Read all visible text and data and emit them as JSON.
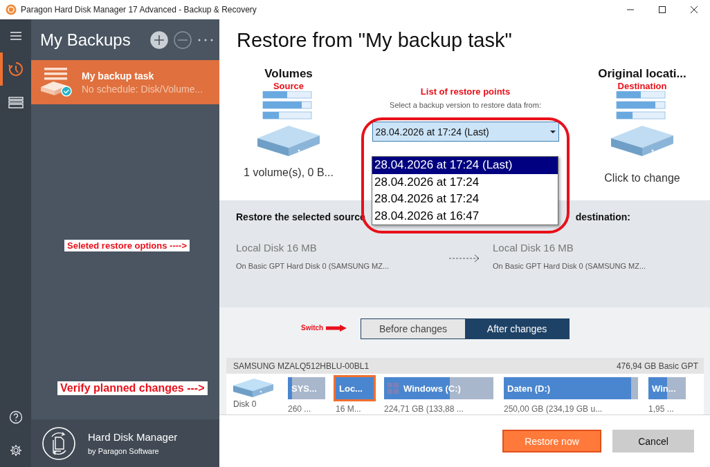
{
  "window": {
    "title": "Paragon Hard Disk Manager 17 Advanced - Backup & Recovery"
  },
  "nav_rail": {
    "items": [
      {
        "kind": "menu",
        "selected": false
      },
      {
        "kind": "backups",
        "selected": true
      },
      {
        "kind": "disks",
        "selected": false
      }
    ],
    "bottom": [
      {
        "kind": "help"
      },
      {
        "kind": "settings"
      }
    ]
  },
  "sidebar": {
    "title": "My Backups",
    "actions": [
      {
        "kind": "add",
        "disabled": false
      },
      {
        "kind": "remove",
        "disabled": true
      },
      {
        "kind": "more",
        "disabled": false
      }
    ],
    "tasks": [
      {
        "name": "My backup task",
        "detail": "No schedule: Disk/Volume...",
        "selected": true
      }
    ],
    "annotations": [
      "Seleted restore options ---->",
      "Verify planned changes --->"
    ],
    "brand": {
      "name": "Hard Disk Manager",
      "vendor": "by Paragon Software"
    }
  },
  "restore": {
    "title": "Restore from \"My backup task\"",
    "source": {
      "label": "Volumes",
      "annotation": "Source",
      "summary": "1 volume(s), 0 B..."
    },
    "restore_points": {
      "annotation": "List of restore points",
      "prompt": "Select a backup version to restore data from:",
      "value": "28.04.2026 at 17:24 (Last)",
      "expanded": true,
      "options": [
        {
          "label": "28.04.2026 at 17:24 (Last)",
          "selected": true
        },
        {
          "label": "28.04.2026 at 17:24",
          "selected": false
        },
        {
          "label": "28.04.2026 at 17:24",
          "selected": false
        },
        {
          "label": "28.04.2026 at 16:47",
          "selected": false
        }
      ]
    },
    "destination": {
      "label": "Original locati...",
      "annotation": "Destination",
      "summary": "Click to change"
    }
  },
  "mapping": {
    "heading_start": "Restore the selected source",
    "heading_end": "destination:",
    "from": {
      "name": "Local Disk 16 MB",
      "location": "On Basic GPT Hard Disk 0 (SAMSUNG MZ..."
    },
    "to": {
      "name": "Local Disk 16 MB",
      "location": "On Basic GPT Hard Disk 0 (SAMSUNG MZ..."
    }
  },
  "view_switch": {
    "annotation": "Switch",
    "options": [
      {
        "label": "Before changes",
        "selected": false
      },
      {
        "label": "After changes",
        "selected": true
      }
    ]
  },
  "disk_map": {
    "disk": "SAMSUNG MZALQ512HBLU-00BL1",
    "info": "476,94 GB Basic GPT",
    "label": "Disk 0",
    "partitions": [
      {
        "name": "SYS...",
        "size": "260 ...",
        "level": 0.12,
        "selected": false,
        "kind": "plain"
      },
      {
        "name": "Loc...",
        "size": "16 M...",
        "level": 1,
        "selected": true,
        "kind": "plain"
      },
      {
        "name": "Windows (C:)",
        "size": "224,71 GB (133,88 ...",
        "level": 0.6,
        "selected": false,
        "kind": "system"
      },
      {
        "name": "Daten (D:)",
        "size": "250,00 GB (234,19 GB u...",
        "level": 0.95,
        "selected": false,
        "kind": "plain"
      },
      {
        "name": "Win...",
        "size": "1,95 ...",
        "level": 0.5,
        "selected": false,
        "kind": "plain"
      }
    ]
  },
  "buttons": [
    {
      "label": "Restore now",
      "kind": "primary"
    },
    {
      "label": "Cancel",
      "kind": "secondary"
    }
  ]
}
